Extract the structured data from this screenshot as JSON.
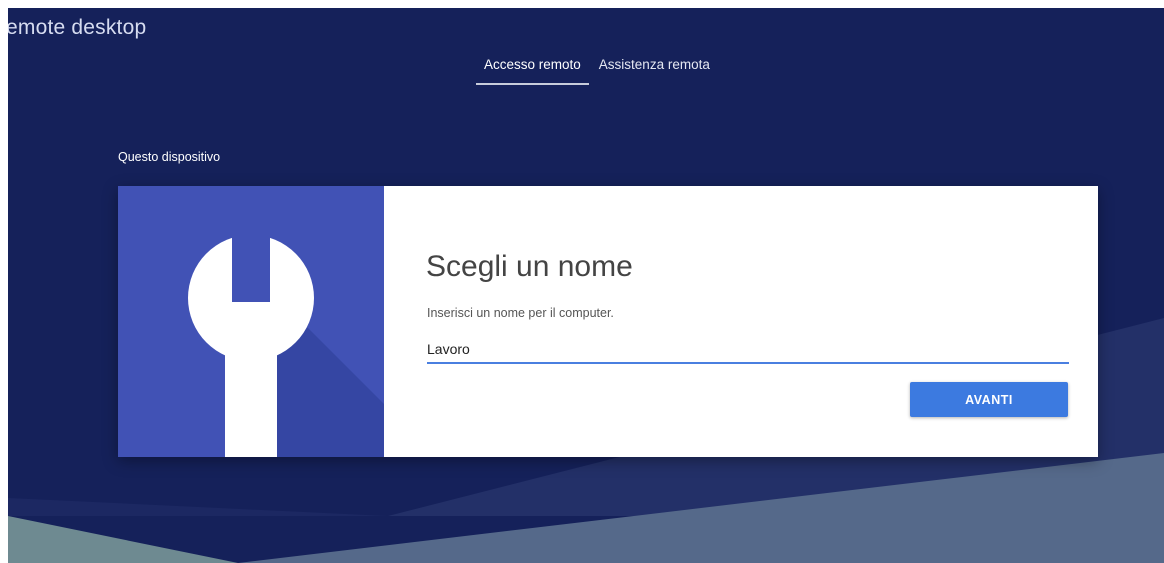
{
  "app": {
    "title": "emote desktop"
  },
  "tabs": [
    {
      "label": "Accesso remoto",
      "active": true
    },
    {
      "label": "Assistenza remota",
      "active": false
    }
  ],
  "section": {
    "label": "Questo dispositivo"
  },
  "card": {
    "icon": "wrench-icon",
    "title": "Scegli un nome",
    "description": "Inserisci un nome per il computer.",
    "name_field": {
      "value": "Lavoro",
      "placeholder": ""
    },
    "next_button_label": "AVANTI"
  },
  "colors": {
    "background": "#15215a",
    "art_panel": "#4152b5",
    "accent": "#3c7ae0"
  }
}
